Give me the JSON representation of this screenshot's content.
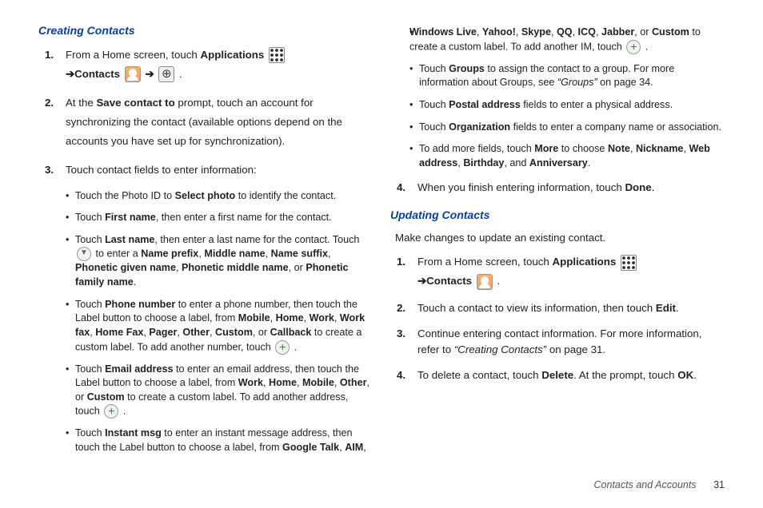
{
  "left": {
    "heading": "Creating Contacts",
    "step1_a": "From a Home screen, touch ",
    "step1_b": "Applications",
    "step1_c": "Contacts",
    "step2_a": "At the ",
    "step2_b": "Save contact to",
    "step2_c": " prompt, touch an account for synchronizing the contact (available options depend on the accounts you have set up for synchronization).",
    "step3": "Touch contact fields to enter information:",
    "b_photo_a": "Touch the Photo ID to ",
    "b_photo_b": "Select photo",
    "b_photo_c": " to identify the contact.",
    "b_fn_a": "Touch ",
    "b_fn_b": "First name",
    "b_fn_c": ", then enter a first name for the contact.",
    "b_ln_a": "Touch ",
    "b_ln_b": "Last name",
    "b_ln_c": ", then enter a last name for the contact. Touch ",
    "b_ln_d": " to enter a ",
    "b_ln_e": "Name prefix",
    "b_ln_f": "Middle name",
    "b_ln_g": "Name suffix",
    "b_ln_h": "Phonetic given name",
    "b_ln_i": "Phonetic middle name",
    "b_ln_j": "Phonetic family name",
    "b_ph_a": "Touch ",
    "b_ph_b": "Phone number",
    "b_ph_c": " to enter a phone number, then touch the Label button to choose a label, from ",
    "b_ph_l1": "Mobile",
    "b_ph_l2": "Home",
    "b_ph_l3": "Work",
    "b_ph_l4": "Work fax",
    "b_ph_l5": "Home Fax",
    "b_ph_l6": "Pager",
    "b_ph_l7": "Other",
    "b_ph_l8": "Custom",
    "b_ph_l9": "Callback",
    "b_ph_d": " to create a custom label. To add another number, touch ",
    "b_em_a": "Touch ",
    "b_em_b": "Email address",
    "b_em_c": " to enter an email address, then touch the Label button to choose a label, from ",
    "b_em_l1": "Work",
    "b_em_l2": "Home",
    "b_em_l3": "Mobile",
    "b_em_l4": "Other",
    "b_em_l5": "Custom",
    "b_em_d": " to create a custom label. To add another address, touch ",
    "b_im_a": "Touch ",
    "b_im_b": "Instant msg",
    "b_im_c": " to enter an instant message address, then touch the Label button to choose a label, from ",
    "b_im_l1": "Google Talk",
    "b_im_l2": "AIM"
  },
  "right": {
    "im_cont_l1": "Windows Live",
    "im_cont_l2": "Yahoo!",
    "im_cont_l3": "Skype",
    "im_cont_l4": "QQ",
    "im_cont_l5": "ICQ",
    "im_cont_l6": "Jabber",
    "im_cont_l7": "Custom",
    "im_cont_a": " to create a custom label. To add another IM, touch ",
    "b_gr_a": "Touch ",
    "b_gr_b": "Groups",
    "b_gr_c": " to assign the contact to a group. For more information about Groups, see ",
    "b_gr_ref": "“Groups”",
    "b_gr_d": " on page 34.",
    "b_pa_a": "Touch ",
    "b_pa_b": "Postal address",
    "b_pa_c": " fields to enter a physical address.",
    "b_org_a": "Touch ",
    "b_org_b": "Organization",
    "b_org_c": " fields to enter a company name or association.",
    "b_more_a": "To add more fields, touch ",
    "b_more_b": "More",
    "b_more_c": " to choose ",
    "b_more_l1": "Note",
    "b_more_l2": "Nickname",
    "b_more_l3": "Web address",
    "b_more_l4": "Birthday",
    "b_more_l5": "Anniversary",
    "step4_a": "When you finish entering information, touch ",
    "step4_b": "Done",
    "heading2": "Updating Contacts",
    "intro2": "Make changes to update an existing contact.",
    "u1_a": "From a Home screen, touch ",
    "u1_b": "Applications",
    "u1_c": "Contacts",
    "u2_a": "Touch a contact to view its information, then touch ",
    "u2_b": "Edit",
    "u3_a": "Continue entering contact information. For more information, refer to ",
    "u3_ref": "“Creating Contacts”",
    "u3_b": " on page 31.",
    "u4_a": "To delete a contact, touch ",
    "u4_b": "Delete",
    "u4_c": ". At the prompt, touch ",
    "u4_d": "OK"
  },
  "footer": {
    "section": "Contacts and Accounts",
    "page": "31"
  }
}
